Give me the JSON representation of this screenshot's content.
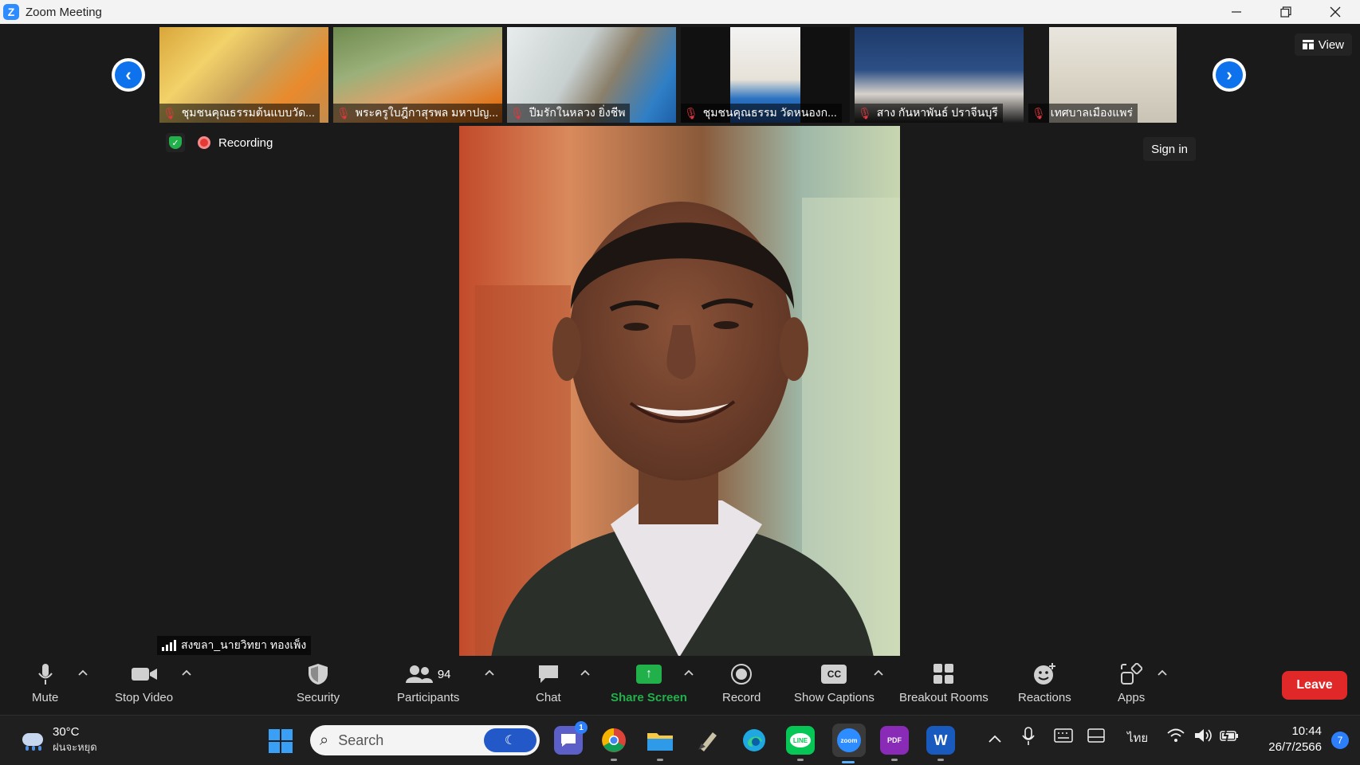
{
  "window": {
    "title": "Zoom Meeting"
  },
  "view_button": {
    "label": "View"
  },
  "thumbnails": [
    {
      "name": "ชุมชนคุณธรรมต้นแบบวัด..."
    },
    {
      "name": "พระครูใบฎีกาสุรพล มหาปญ..."
    },
    {
      "name": "ปีมรักในหลวง ยิ่งชีพ"
    },
    {
      "name": "ชุมชนคุณธรรม วัดหนองก..."
    },
    {
      "name": "สาง กันหาพันธ์ ปราจีนบุรี"
    },
    {
      "name": "เทศบาลเมืองแพร่"
    }
  ],
  "status": {
    "recording_label": "Recording"
  },
  "sign_in": {
    "label": "Sign in"
  },
  "active_speaker": {
    "name": "สงขลา_นายวิทยา  ทองเพ็ง"
  },
  "toolbar": {
    "mute": "Mute",
    "stop_video": "Stop Video",
    "security": "Security",
    "participants": "Participants",
    "participants_count": "94",
    "chat": "Chat",
    "share_screen": "Share Screen",
    "record": "Record",
    "show_captions": "Show Captions",
    "captions_badge": "CC",
    "breakout_rooms": "Breakout Rooms",
    "reactions": "Reactions",
    "apps": "Apps",
    "leave": "Leave"
  },
  "taskbar": {
    "temperature": "30°C",
    "weather_condition": "ฝนจะหยุด",
    "search_placeholder": "Search",
    "teams_badge": "1",
    "zoom_label": "zoom",
    "word_label": "W",
    "pdf_label": "PDF",
    "language": "ไทย",
    "time": "10:44",
    "date": "26/7/2566",
    "notification_count": "7"
  },
  "colors": {
    "accent_blue": "#0e72ed",
    "share_green": "#22b04b",
    "leave_red": "#e02828",
    "background": "#1a1a1a"
  }
}
